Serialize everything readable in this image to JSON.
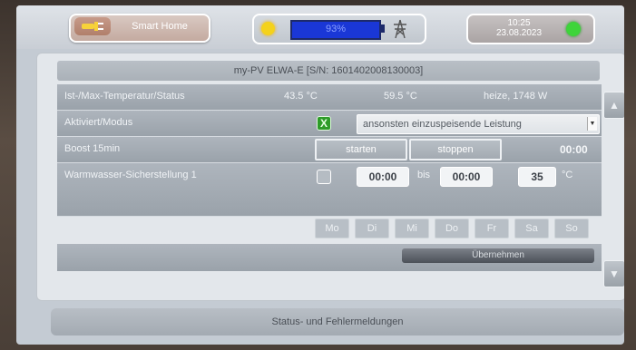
{
  "header": {
    "home_label": "Smart Home",
    "battery_percent": "93%",
    "battery_level": 0.93,
    "time": "10:25",
    "date": "23.08.2023",
    "status_color": "#3ed43a"
  },
  "device": {
    "title": "my-PV ELWA-E [S/N: 1601402008130003]"
  },
  "rows": {
    "temp": {
      "label": "Ist-/Max-Temperatur/Status",
      "current": "43.5 °C",
      "max": "59.5 °C",
      "status": "heize, 1748 W"
    },
    "mode": {
      "label": "Aktiviert/Modus",
      "checkbox": "X",
      "select": "ansonsten einzuspeisende Leistung"
    },
    "boost": {
      "label": "Boost 15min",
      "start": "starten",
      "stop": "stoppen",
      "time": "00:00"
    },
    "warmwater": {
      "label": "Warmwasser-Sicherstellung 1",
      "from": "00:00",
      "bis": "bis",
      "to": "00:00",
      "temp": "35",
      "unit": "°C"
    }
  },
  "days": [
    "Mo",
    "Di",
    "Mi",
    "Do",
    "Fr",
    "Sa",
    "So"
  ],
  "apply_label": "Übernehmen",
  "footer": "Status- und Fehlermeldungen",
  "icons": {
    "scroll_up": "▲",
    "scroll_down": "▼",
    "select_arrow": "▼"
  }
}
